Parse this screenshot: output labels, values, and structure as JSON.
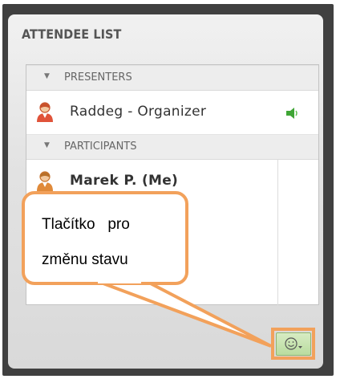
{
  "panel": {
    "title": "ATTENDEE LIST"
  },
  "groups": [
    {
      "label": "PRESENTERS"
    },
    {
      "label": "PARTICIPANTS"
    }
  ],
  "attendees": [
    {
      "name": "Raddeg - Organizer",
      "role": "presenter",
      "audio": "speaker-icon"
    },
    {
      "name": "Marek P. (Me)",
      "role": "participant"
    }
  ],
  "callout": {
    "line1": "Tlačítko   pro",
    "line2": "změnu stavu"
  },
  "status_button": {
    "icon": "smiley-icon",
    "symbol": "☺▾"
  },
  "colors": {
    "accent_orange": "#f2a15b",
    "status_green": "#c6e4ad",
    "frame": "#404040"
  }
}
